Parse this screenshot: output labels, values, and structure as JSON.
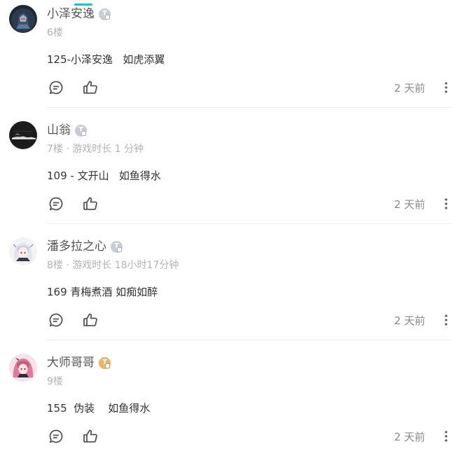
{
  "comments": [
    {
      "username": "小泽安逸",
      "badge_color": "#c9cdd3",
      "badge_letter": "T",
      "meta": "6楼",
      "content": "125-小泽安逸   如虎添翼",
      "time": "2 天前",
      "avatar_icon": "armored-robot-avatar"
    },
    {
      "username": "山翁",
      "badge_color": "#c9cdd3",
      "badge_letter": "T",
      "meta": "7楼 · 游戏时长 1 分钟",
      "content": "109 - 文开山   如鱼得水",
      "time": "2 天前",
      "avatar_icon": "dark-landscape-avatar"
    },
    {
      "username": "潘多拉之心",
      "badge_color": "#c9cdd3",
      "badge_letter": "T",
      "meta": "8楼 · 游戏时长 18小时17分钟",
      "content": "169 青梅煮酒 如痴如醉",
      "time": "2 天前",
      "avatar_icon": "anime-girl-white-hair-avatar"
    },
    {
      "username": "大师哥哥",
      "badge_color": "#e9b56a",
      "badge_letter": "T",
      "meta": "9楼",
      "content": "155  伪装    如鱼得水",
      "time": "2 天前",
      "avatar_icon": "anime-girl-pink-hair-avatar"
    }
  ]
}
